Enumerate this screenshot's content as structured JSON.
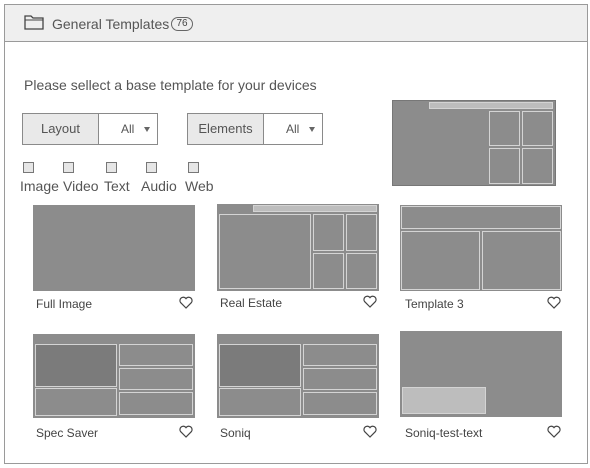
{
  "header": {
    "title": "General Templates",
    "count": "76"
  },
  "instruction": "Please sellect a base template for your devices",
  "filters": {
    "layout": {
      "label": "Layout",
      "value": "All"
    },
    "elements": {
      "label": "Elements",
      "value": "All"
    }
  },
  "checkboxes": [
    "Image",
    "Video",
    "Text",
    "Audio",
    "Web"
  ],
  "templates": [
    {
      "name": "Full Image"
    },
    {
      "name": "Real Estate"
    },
    {
      "name": "Template 3"
    },
    {
      "name": "Spec Saver"
    },
    {
      "name": "Soniq"
    },
    {
      "name": "Soniq-test-text"
    }
  ],
  "colors": {
    "thumbnail": "#8c8c8c",
    "header_bg": "#efefef",
    "border": "#9a9a9a"
  },
  "icons": {
    "folder": "folder-icon",
    "favorite": "heart-icon",
    "dropdown": "caret-down-icon"
  }
}
